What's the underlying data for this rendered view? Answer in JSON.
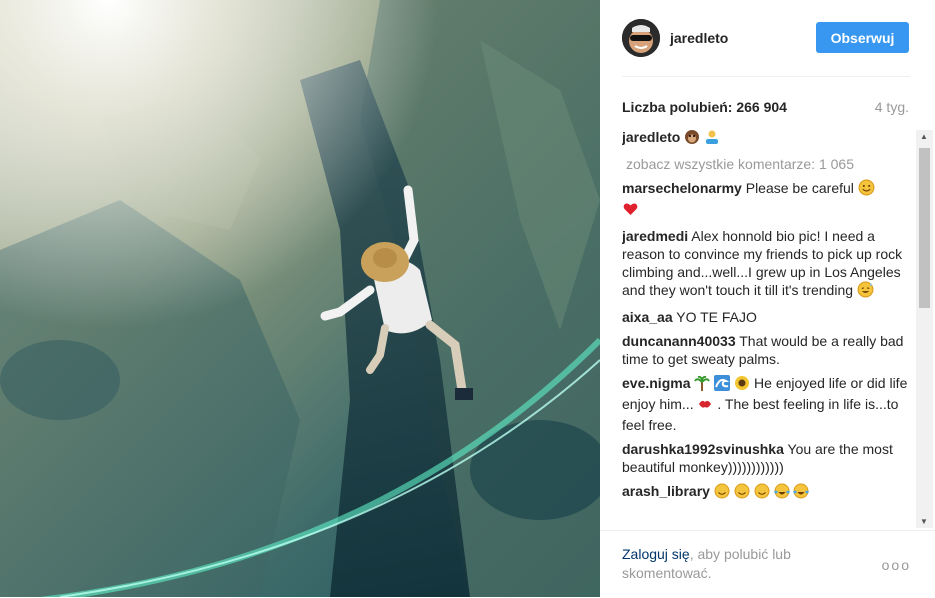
{
  "post": {
    "username": "jaredleto",
    "follow_label": "Obserwuj",
    "likes_label": "Liczba polubień: 266 904",
    "age": "4 tyg.",
    "caption_user": "jaredleto",
    "view_all_comments": "zobacz wszystkie komentarze: 1 065"
  },
  "comments": [
    {
      "user": "marsechelonarmy",
      "text": "Please be careful"
    },
    {
      "user": "jaredmedi",
      "text": "Alex honnold bio pic! I need a reason to convince my friends to pick up rock climbing and...well...I grew up in Los Angeles and they won't touch it till it's trending"
    },
    {
      "user": "aixa_aa",
      "text": "YO TE FAJO"
    },
    {
      "user": "duncanann40033",
      "text": "That would be a really bad time to get sweaty palms."
    },
    {
      "user": "eve.nigma",
      "text_a": "He enjoyed life or did life enjoy him...",
      "text_b": ". The best feeling in life is...to feel free."
    },
    {
      "user": "darushka1992svinushka",
      "text": "You are the most beautiful monkey))))))))))))"
    },
    {
      "user": "arash_library",
      "text": ""
    }
  ],
  "footer": {
    "login_link": "Zaloguj się",
    "login_rest": ", aby polubić lub skomentować.",
    "more": "ooo"
  },
  "colors": {
    "accent": "#3897f0",
    "link": "#003569",
    "muted": "#999999"
  },
  "icons": [
    "heart-emoji",
    "monkey-emoji",
    "palm-emoji",
    "wave-emoji",
    "sunflower-emoji",
    "lips-emoji",
    "smile-emoji",
    "tears-emoji"
  ]
}
